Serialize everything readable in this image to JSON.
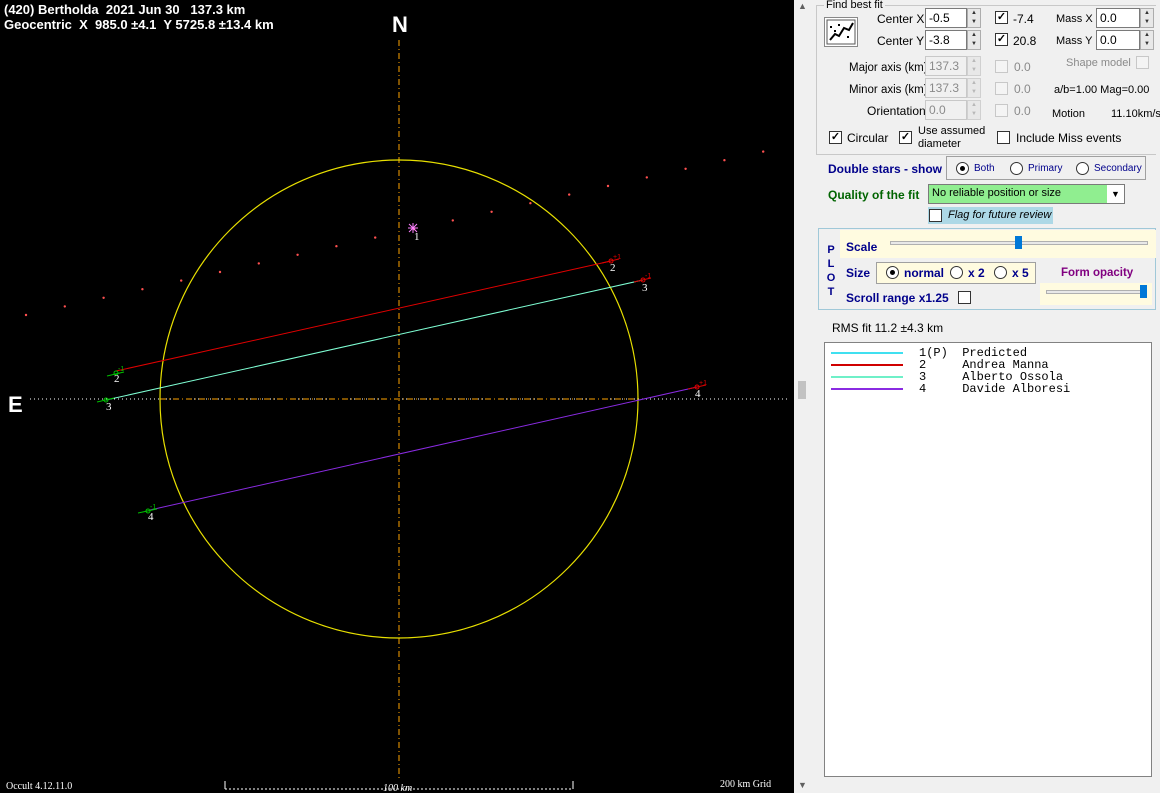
{
  "plot": {
    "title_line1": "(420) Bertholda  2021 Jun 30   137.3 km",
    "title_line2": "Geocentric  X  985.0 ±4.1  Y 5725.8 ±13.4 km",
    "north_label": "N",
    "east_label": "E",
    "version_label": "Occult 4.12.11.0",
    "scale_bar_label": "100 km",
    "grid_label": "200 km Grid",
    "chords": [
      {
        "id": "1",
        "label": "1"
      },
      {
        "id": "2",
        "label": "2",
        "color": "#e00000"
      },
      {
        "id": "3",
        "label": "3",
        "color": "#7fffd4"
      },
      {
        "id": "4",
        "label": "4",
        "color": "#8a2be2"
      }
    ],
    "outline_color": "#e8e000",
    "axis_color": "#ffa500"
  },
  "panel": {
    "find_best_fit": {
      "group_label": "Find best fit",
      "center_x_label": "Center X",
      "center_x_value": "-0.5",
      "center_y_label": "Center Y",
      "center_y_value": "-3.8",
      "check_x_value": "-7.4",
      "check_y_value": "20.8",
      "mass_x_label": "Mass X",
      "mass_x_value": "0.0",
      "mass_y_label": "Mass Y",
      "mass_y_value": "0.0",
      "shape_model_label": "Shape model",
      "major_axis_label": "Major axis (km)",
      "major_axis_value": "137.3",
      "major_axis_fit": "0.0",
      "minor_axis_label": "Minor axis (km)",
      "minor_axis_value": "137.3",
      "minor_axis_fit": "0.0",
      "ab_label": "a/b=1.00  Mag=0.00",
      "orientation_label": "Orientation",
      "orientation_value": "0.0",
      "orientation_fit": "0.0",
      "motion_label": "Motion",
      "motion_value": "11.10km/s",
      "circular_label": "Circular",
      "use_assumed_label_1": "Use assumed",
      "use_assumed_label_2": "diameter",
      "include_miss_label": "Include Miss events"
    },
    "double_stars": {
      "label": "Double stars - show",
      "options": [
        "Both",
        "Primary",
        "Secondary"
      ],
      "selected": "Both"
    },
    "quality": {
      "label": "Quality of the fit",
      "value": "No reliable position or size",
      "flag_label": "Flag for future review"
    },
    "plot_box": {
      "vertical_label": [
        "P",
        "L",
        "O",
        "T"
      ],
      "scale_label": "Scale",
      "scale_level": 0.5,
      "size_label": "Size",
      "size_options": [
        "normal",
        "x 2",
        "x 5"
      ],
      "size_selected": "normal",
      "form_opacity_label": "Form opacity",
      "opacity_level": 1.0,
      "scroll_range_label": "Scroll range x1.25"
    },
    "rms_label": "RMS fit 11.2 ±4.3 km",
    "legend": [
      {
        "num": "1(P)",
        "name": "Predicted",
        "color": "#40e0f0"
      },
      {
        "num": "2",
        "name": "Andrea Manna",
        "color": "#d00000"
      },
      {
        "num": "3",
        "name": "Alberto Ossola",
        "color": "#6ff0c8"
      },
      {
        "num": "4",
        "name": "Davide Alboresi",
        "color": "#8a2be2"
      }
    ]
  }
}
